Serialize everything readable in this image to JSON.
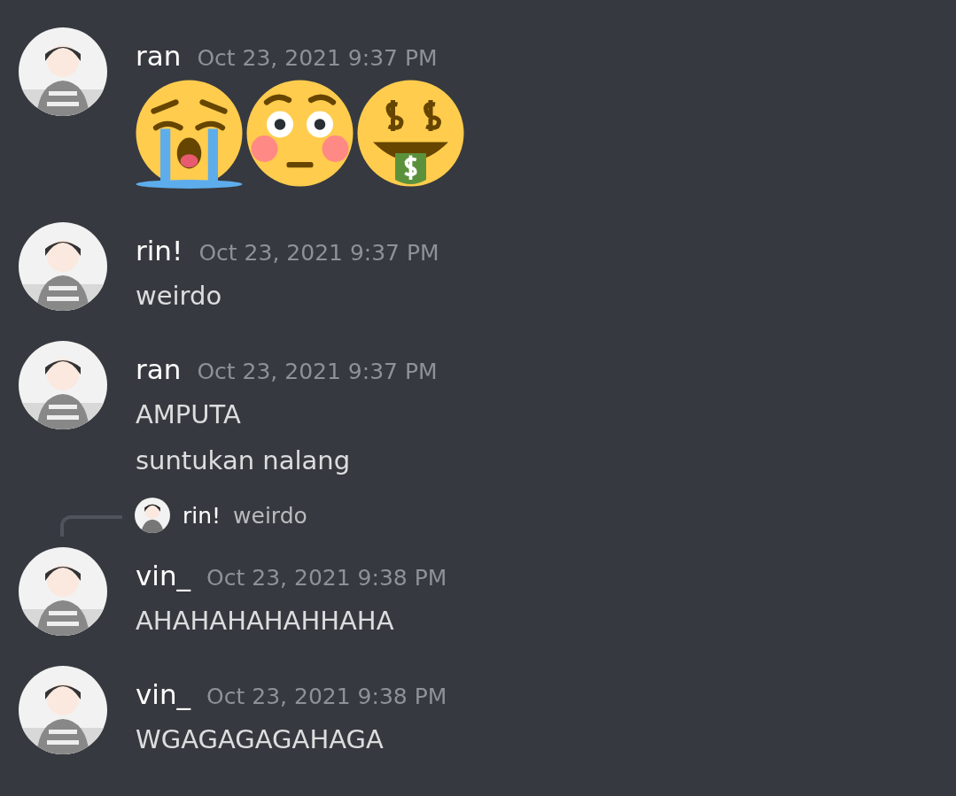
{
  "messages": [
    {
      "author": "ran",
      "timestamp": "Oct 23, 2021 9:37 PM",
      "kind": "emoji",
      "emojis": [
        {
          "kind": "crying"
        },
        {
          "kind": "flushed"
        },
        {
          "kind": "money"
        }
      ]
    },
    {
      "author": "rin!",
      "timestamp": "Oct 23, 2021 9:37 PM",
      "kind": "text",
      "lines": [
        "weirdo"
      ]
    },
    {
      "author": "ran",
      "timestamp": "Oct 23, 2021 9:37 PM",
      "kind": "text",
      "lines": [
        "AMPUTA",
        "suntukan nalang"
      ]
    },
    {
      "author": "vin_",
      "timestamp": "Oct 23, 2021 9:38 PM",
      "kind": "text",
      "reply": {
        "author": "rin!",
        "text": "weirdo"
      },
      "lines": [
        "AHAHAHAHAHHAHA"
      ]
    },
    {
      "author": "vin_",
      "timestamp": "Oct 23, 2021 9:38 PM",
      "kind": "text",
      "lines": [
        "WGAGAGAGAHAGA"
      ]
    }
  ]
}
